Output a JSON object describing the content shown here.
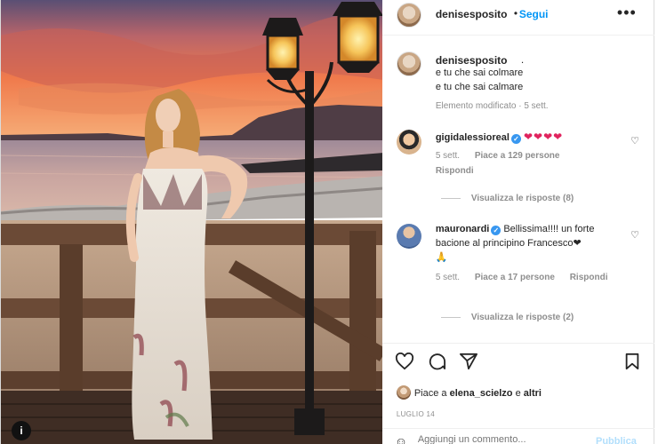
{
  "header": {
    "username": "denisesposito",
    "separator": "•",
    "follow_label": "Segui",
    "more_label": "•••"
  },
  "caption": {
    "username": "denisesposito",
    "dot": ".",
    "lines": [
      "e tu che sai colmare",
      "e tu che sai calmare"
    ],
    "meta": "Elemento modificato · 5 sett."
  },
  "comments": [
    {
      "username": "gigidalessioreal",
      "verified": true,
      "text": "❤❤❤❤",
      "time": "5 sett.",
      "likes": "Piace a 129 persone",
      "reply": "Rispondi",
      "view_replies": "Visualizza le risposte (8)"
    },
    {
      "username": "mauronardi",
      "verified": true,
      "text_line1": "Bellissima!!!! un forte",
      "text_line2": "bacione al principino Francesco❤",
      "text_line3": "🙏",
      "time": "5 sett.",
      "likes": "Piace a 17 persone",
      "reply": "Rispondi",
      "view_replies": "Visualizza le risposte (2)"
    }
  ],
  "likes": {
    "prefix": "Piace a",
    "user": "elena_scielzo",
    "joiner": "e",
    "others": "altri"
  },
  "date": "LUGLIO 14",
  "comment_box": {
    "placeholder": "Aggiungi un commento...",
    "publish_label": "Pubblica"
  },
  "photo": {
    "badge": "i"
  },
  "icons": {
    "heart": "heart-icon",
    "comment": "comment-icon",
    "share": "share-icon",
    "save": "bookmark-icon",
    "emoji": "emoji-icon"
  },
  "colors": {
    "link_blue": "#0095f6",
    "verified_blue": "#3897f0",
    "heart_red": "#e0245e",
    "muted": "#8e8e8e"
  }
}
